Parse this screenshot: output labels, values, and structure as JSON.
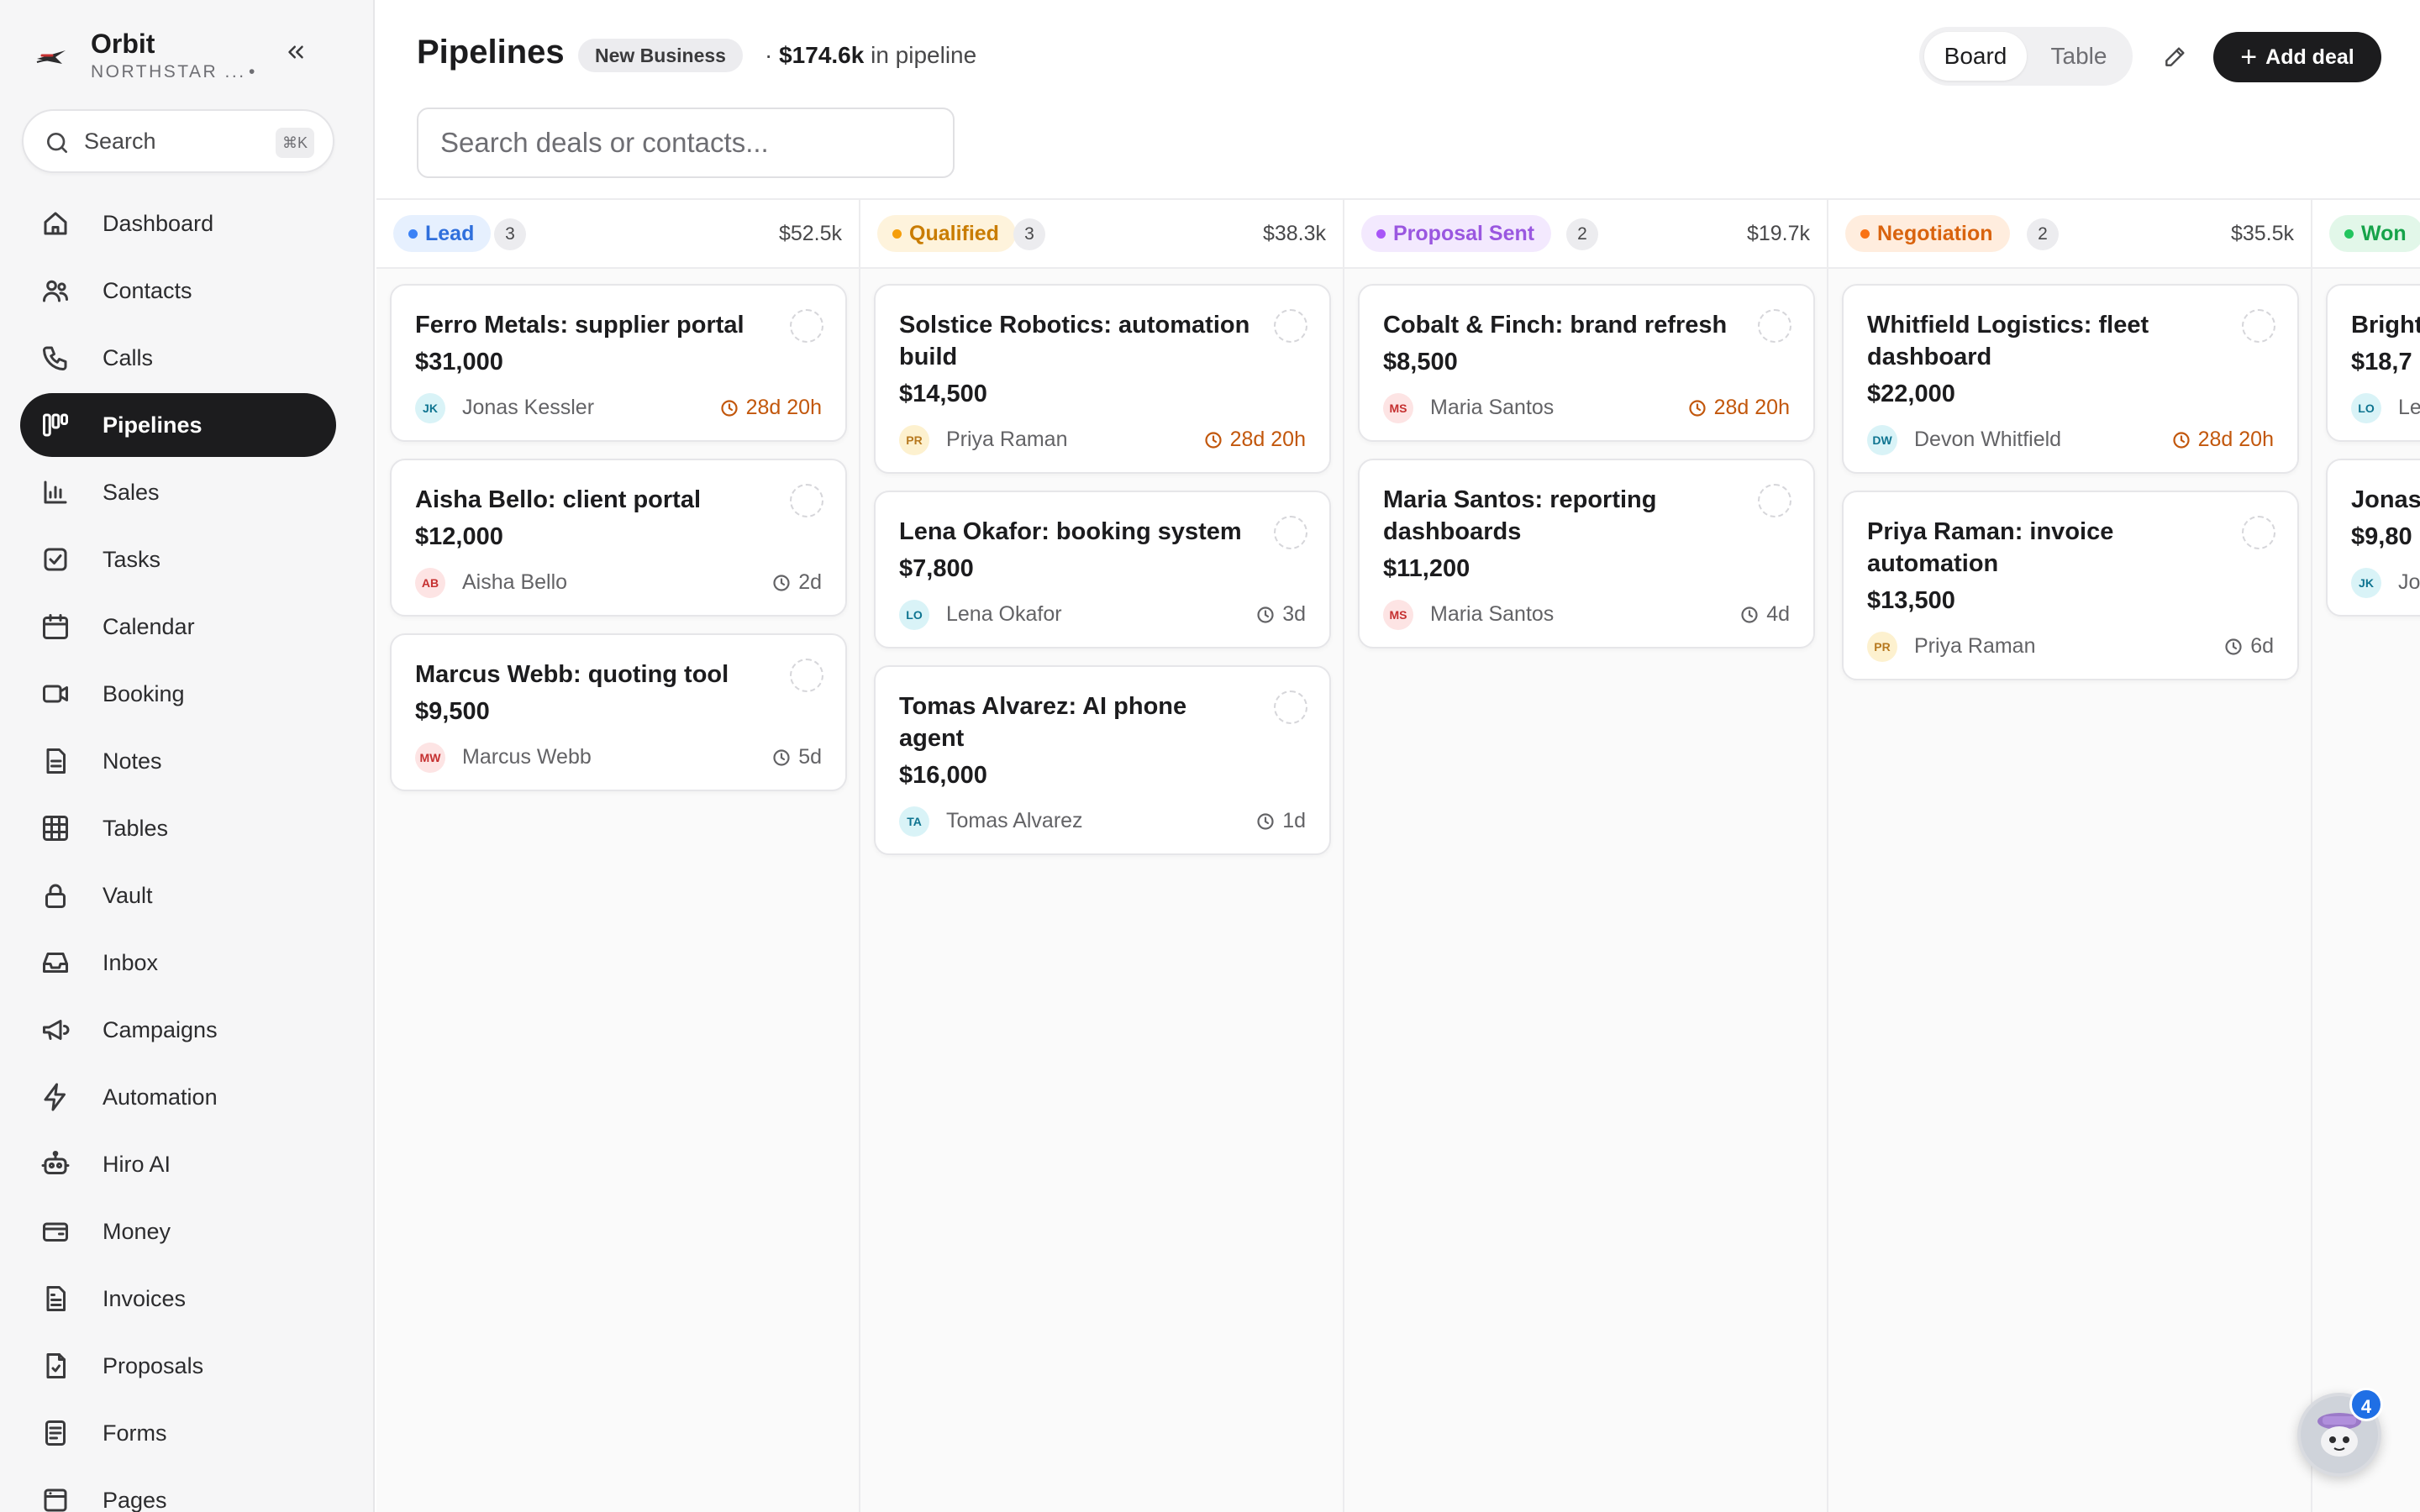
{
  "app": {
    "name": "Orbit",
    "workspace": "NORTHSTAR ...",
    "workspace_dot": "•"
  },
  "sidebar": {
    "search_label": "Search",
    "search_shortcut": "⌘K",
    "items": [
      {
        "label": "Dashboard",
        "icon": "home-icon",
        "active": false
      },
      {
        "label": "Contacts",
        "icon": "users-icon",
        "active": false
      },
      {
        "label": "Calls",
        "icon": "phone-icon",
        "active": false
      },
      {
        "label": "Pipelines",
        "icon": "pipeline-icon",
        "active": true
      },
      {
        "label": "Sales",
        "icon": "bar-chart-icon",
        "active": false
      },
      {
        "label": "Tasks",
        "icon": "checkbox-icon",
        "active": false
      },
      {
        "label": "Calendar",
        "icon": "calendar-icon",
        "active": false
      },
      {
        "label": "Booking",
        "icon": "video-icon",
        "active": false
      },
      {
        "label": "Notes",
        "icon": "note-icon",
        "active": false
      },
      {
        "label": "Tables",
        "icon": "grid-icon",
        "active": false
      },
      {
        "label": "Vault",
        "icon": "lock-icon",
        "active": false
      },
      {
        "label": "Inbox",
        "icon": "inbox-icon",
        "active": false
      },
      {
        "label": "Campaigns",
        "icon": "megaphone-icon",
        "active": false
      },
      {
        "label": "Automation",
        "icon": "bolt-icon",
        "active": false
      },
      {
        "label": "Hiro AI",
        "icon": "robot-icon",
        "active": false
      },
      {
        "label": "Money",
        "icon": "wallet-icon",
        "active": false
      },
      {
        "label": "Invoices",
        "icon": "invoice-icon",
        "active": false
      },
      {
        "label": "Proposals",
        "icon": "proposal-icon",
        "active": false
      },
      {
        "label": "Forms",
        "icon": "form-icon",
        "active": false
      },
      {
        "label": "Pages",
        "icon": "pages-icon",
        "active": false
      }
    ]
  },
  "header": {
    "title": "Pipelines",
    "pipeline_badge": "New Business",
    "total_prefix": "·",
    "total_value": "$174.6k",
    "total_suffix": "in pipeline",
    "view_board": "Board",
    "view_table": "Table",
    "add_deal": "Add deal",
    "search_placeholder": "Search deals or contacts..."
  },
  "colors": {
    "lead": "#3b82f6",
    "qualified": "#f59e0b",
    "proposal": "#a855f7",
    "negotiation": "#f97316",
    "won": "#22c55e",
    "warn": "#c2570c",
    "accent": "#1c1c1e"
  },
  "columns": [
    {
      "stage": "Lead",
      "count": "3",
      "total": "$52.5k",
      "cards": [
        {
          "title": "Ferro Metals: supplier portal",
          "amount": "$31,000",
          "initials": "JK",
          "contact": "Jonas Kessler",
          "age": "28d 20h",
          "warn": true
        },
        {
          "title": "Aisha Bello: client portal",
          "amount": "$12,000",
          "initials": "AB",
          "contact": "Aisha Bello",
          "age": "2d",
          "warn": false
        },
        {
          "title": "Marcus Webb: quoting tool",
          "amount": "$9,500",
          "initials": "MW",
          "contact": "Marcus Webb",
          "age": "5d",
          "warn": false
        }
      ]
    },
    {
      "stage": "Qualified",
      "count": "3",
      "total": "$38.3k",
      "cards": [
        {
          "title": "Solstice Robotics: automation build",
          "amount": "$14,500",
          "initials": "PR",
          "contact": "Priya Raman",
          "age": "28d 20h",
          "warn": true
        },
        {
          "title": "Lena Okafor: booking system",
          "amount": "$7,800",
          "initials": "LO",
          "contact": "Lena Okafor",
          "age": "3d",
          "warn": false
        },
        {
          "title": "Tomas Alvarez: AI phone agent",
          "amount": "$16,000",
          "initials": "TA",
          "contact": "Tomas Alvarez",
          "age": "1d",
          "warn": false
        }
      ]
    },
    {
      "stage": "Proposal Sent",
      "count": "2",
      "total": "$19.7k",
      "cards": [
        {
          "title": "Cobalt & Finch: brand refresh",
          "amount": "$8,500",
          "initials": "MS",
          "contact": "Maria Santos",
          "age": "28d 20h",
          "warn": true
        },
        {
          "title": "Maria Santos: reporting dashboards",
          "amount": "$11,200",
          "initials": "MS",
          "contact": "Maria Santos",
          "age": "4d",
          "warn": false
        }
      ]
    },
    {
      "stage": "Negotiation",
      "count": "2",
      "total": "$35.5k",
      "cards": [
        {
          "title": "Whitfield Logistics: fleet dashboard",
          "amount": "$22,000",
          "initials": "DW",
          "contact": "Devon Whitfield",
          "age": "28d 20h",
          "warn": true
        },
        {
          "title": "Priya Raman: invoice automation",
          "amount": "$13,500",
          "initials": "PR",
          "contact": "Priya Raman",
          "age": "6d",
          "warn": false
        }
      ]
    },
    {
      "stage": "Won",
      "cards": [
        {
          "title": "Bright intake",
          "amount": "$18,7",
          "initials": "LO",
          "contact": "Le"
        },
        {
          "title": "Jonas autom",
          "amount": "$9,80",
          "initials": "JK",
          "contact": "Jo"
        }
      ]
    }
  ],
  "assistant": {
    "badge": "4"
  }
}
